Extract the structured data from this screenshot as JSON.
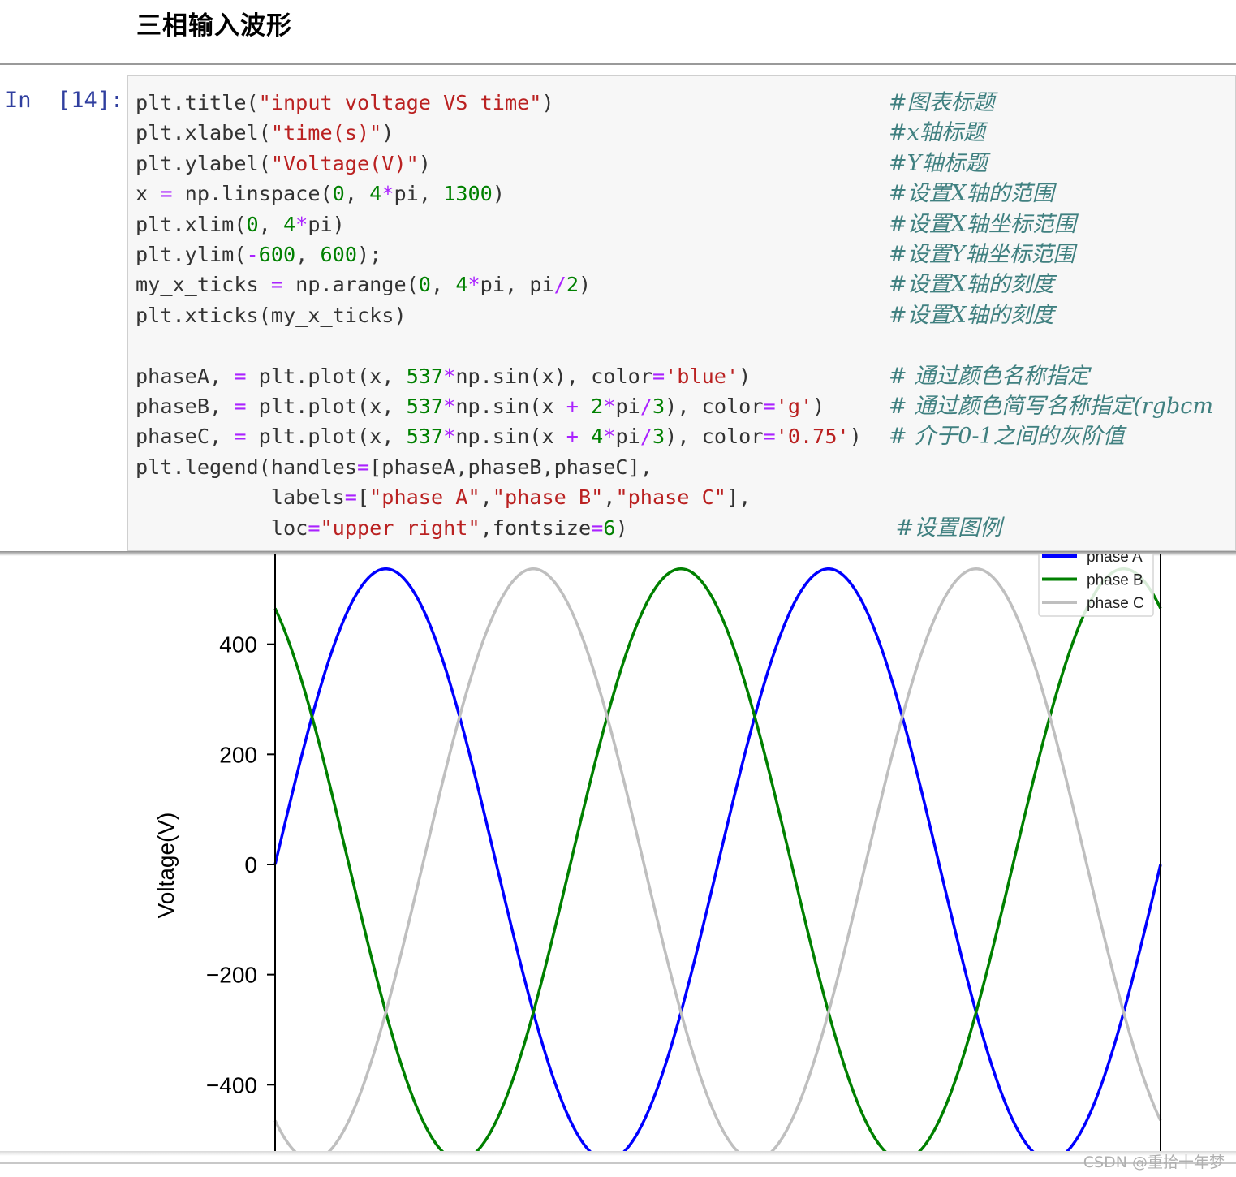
{
  "notebook": {
    "heading": "三相输入波形",
    "prompt": "In  [14]:",
    "code_lines": [
      "plt.title(\"input voltage VS time\")",
      "plt.xlabel(\"time(s)\")",
      "plt.ylabel(\"Voltage(V)\")",
      "x = np.linspace(0, 4*pi, 1300)",
      "plt.xlim(0, 4*pi)",
      "plt.ylim(-600, 600);",
      "my_x_ticks = np.arange(0, 4*pi, pi/2)",
      "plt.xticks(my_x_ticks)",
      "",
      "phaseA, = plt.plot(x, 537*np.sin(x), color='blue')",
      "phaseB, = plt.plot(x, 537*np.sin(x + 2*pi/3), color='g')",
      "phaseC, = plt.plot(x, 537*np.sin(x + 4*pi/3), color='0.75')",
      "plt.legend(handles=[phaseA,phaseB,phaseC],",
      "           labels=[\"phase A\",\"phase B\",\"phase C\"],",
      "           loc=\"upper right\",fontsize=6)"
    ],
    "comment_lines": [
      "#图表标题",
      "#x轴标题",
      "#Y轴标题",
      "#设置X轴的范围",
      "#设置X轴坐标范围",
      "#设置Y轴坐标范围",
      "#设置X轴的刻度",
      "#设置X轴的刻度",
      "",
      "# 通过颜色名称指定",
      "# 通过颜色简写名称指定(rgbcm",
      "# 介于0-1之间的灰阶值",
      "",
      "",
      " #设置图例"
    ],
    "watermark": "CSDN @重拾十年梦"
  },
  "chart_data": {
    "type": "line",
    "title": "",
    "xlabel": "",
    "ylabel": "Voltage(V)",
    "xlim": [
      0,
      12.566
    ],
    "ylim_visible": [
      -520,
      545
    ],
    "yticks": [
      400,
      200,
      0,
      -200,
      -400
    ],
    "ytick_labels": [
      "400",
      "200",
      "0",
      "−200",
      "−400"
    ],
    "legend": "top-right",
    "grid": false,
    "series": [
      {
        "name": "phase A",
        "color": "#0000ff",
        "amplitude": 537,
        "phase": 0
      },
      {
        "name": "phase B",
        "color": "#008000",
        "amplitude": 537,
        "phase": 2.0944
      },
      {
        "name": "phase C",
        "color": "#bfbfbf",
        "amplitude": 537,
        "phase": 4.18879
      }
    ]
  }
}
